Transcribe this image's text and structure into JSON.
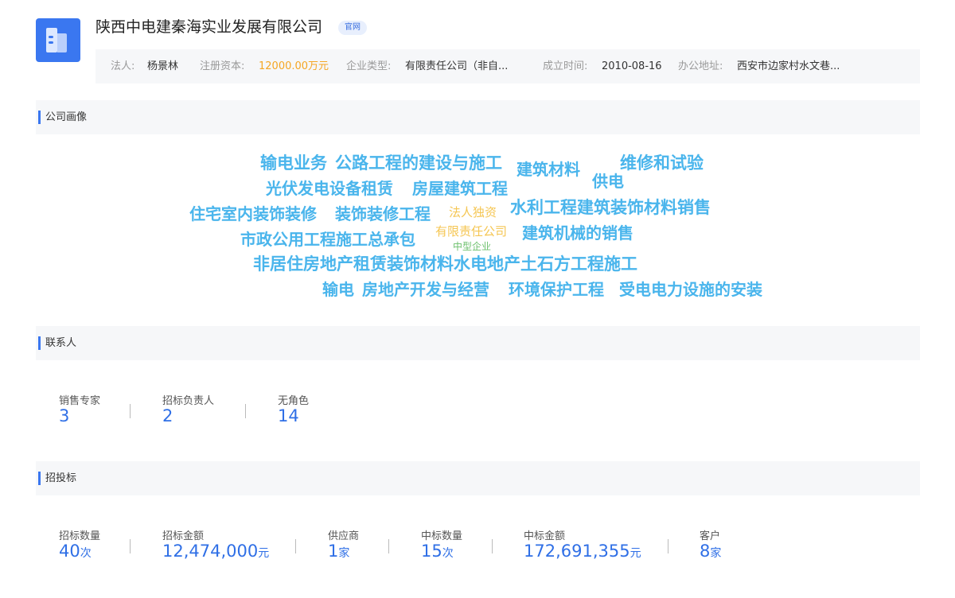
{
  "company": {
    "name": "陕西中电建秦海实业发展有限公司",
    "official_tag": "官网"
  },
  "info": {
    "legal_person_label": "法人:",
    "legal_person": "杨景林",
    "capital_label": "注册资本:",
    "capital": "12000.00万元",
    "type_label": "企业类型:",
    "type": "有限责任公司（非自...",
    "founded_label": "成立时间:",
    "founded": "2010-08-16",
    "address_label": "办公地址:",
    "address": "西安市边家村水文巷..."
  },
  "portrait": {
    "title": "公司画像",
    "words": [
      "输电业务",
      "公路工程的建设与施工",
      "建筑材料",
      "维修和试验",
      "供电",
      "光伏发电设备租赁",
      "房屋建筑工程",
      "住宅室内装饰装修",
      "装饰装修工程",
      "法人独资",
      "水利工程建筑装饰材料销售",
      "市政公用工程施工总承包",
      "有限责任公司",
      "建筑机械的销售",
      "中型企业",
      "非居住房地产租赁装饰材料水电地产土石方工程施工",
      "输电",
      "房地产开发与经营",
      "环境保护工程",
      "受电电力设施的安装"
    ]
  },
  "contacts": {
    "title": "联系人",
    "stats": [
      {
        "label": "销售专家",
        "value": "3"
      },
      {
        "label": "招标负责人",
        "value": "2"
      },
      {
        "label": "无角色",
        "value": "14"
      }
    ]
  },
  "bidding": {
    "title": "招投标",
    "stats": [
      {
        "label": "招标数量",
        "value": "40",
        "unit": "次"
      },
      {
        "label": "招标金额",
        "value": "12,474,000",
        "unit": "元"
      },
      {
        "label": "供应商",
        "value": "1",
        "unit": "家"
      },
      {
        "label": "中标数量",
        "value": "15",
        "unit": "次"
      },
      {
        "label": "中标金额",
        "value": "172,691,355",
        "unit": "元"
      },
      {
        "label": "客户",
        "value": "8",
        "unit": "家"
      }
    ]
  },
  "colors": {
    "accent": "#3a77f0",
    "number": "#2f6fe6",
    "cloud_blue": "#4ab5ec",
    "cloud_yellow": "#f5c653",
    "cloud_green": "#6cc06c",
    "capital": "#f5a623"
  }
}
